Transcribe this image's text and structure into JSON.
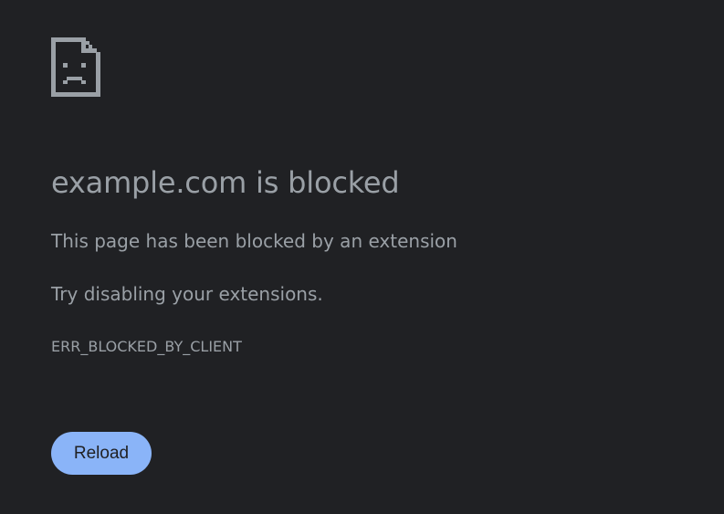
{
  "error_page": {
    "icon": "sad-page-icon",
    "title": "example.com is blocked",
    "subtitle": "This page has been blocked by an extension",
    "suggestion": "Try disabling your extensions.",
    "error_code": "ERR_BLOCKED_BY_CLIENT",
    "reload_label": "Reload"
  },
  "colors": {
    "background": "#202124",
    "text": "#9aa0a6",
    "button_bg": "#8ab4f8",
    "button_text": "#202124"
  }
}
